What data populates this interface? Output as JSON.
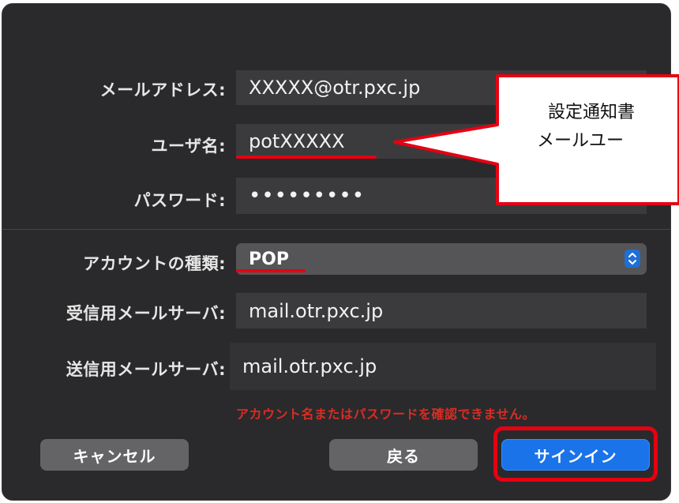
{
  "form": {
    "email_label": "メールアドレス:",
    "email_value": "XXXXX@otr.pxc.jp",
    "username_label": "ユーザ名:",
    "username_value": "potXXXXX",
    "password_label": "パスワード:",
    "password_value": "•••••••••",
    "account_type_label": "アカウントの種類:",
    "account_type_value": "POP",
    "incoming_label": "受信用メールサーバ:",
    "incoming_value": "mail.otr.pxc.jp",
    "outgoing_label": "送信用メールサーバ:",
    "outgoing_value": "mail.otr.pxc.jp"
  },
  "error_message": "アカウント名またはパスワードを確認できません。",
  "buttons": {
    "cancel": "キャンセル",
    "back": "戻る",
    "signin": "サインイン"
  },
  "callout": {
    "line1": "設定通知書",
    "line2": "メールユー"
  },
  "colors": {
    "annotation_red": "#e60012",
    "primary_blue": "#1a73e8",
    "error_red": "#d92d25"
  }
}
